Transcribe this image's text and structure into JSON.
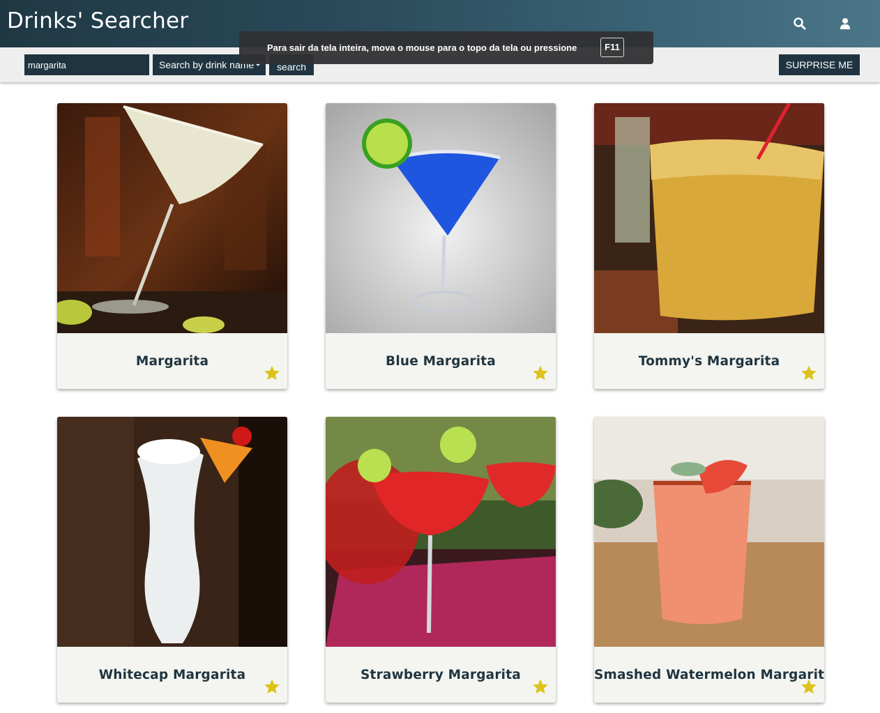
{
  "header": {
    "title": "Drinks' Searcher",
    "icons": [
      "search-icon",
      "user-icon"
    ]
  },
  "search": {
    "query": "margarita",
    "filter_selected": "Search by drink name",
    "search_label": "search",
    "surprise_label": "SURPRISE ME"
  },
  "fullscreen_notice": {
    "message": "Para sair da tela inteira, mova o mouse para o topo da tela ou pressione",
    "key": "F11"
  },
  "drinks": [
    {
      "name": "Margarita",
      "favorite": true
    },
    {
      "name": "Blue Margarita",
      "favorite": true
    },
    {
      "name": "Tommy's Margarita",
      "favorite": true
    },
    {
      "name": "Whitecap Margarita",
      "favorite": true
    },
    {
      "name": "Strawberry Margarita",
      "favorite": true
    },
    {
      "name": "Smashed Watermelon Margarita",
      "favorite": true
    }
  ],
  "colors": {
    "header_dark": "#1f3844",
    "header_light": "#4a7688",
    "control_bg": "#1f3440",
    "card_bg": "#f4f5f0",
    "star": "#dcc31a"
  }
}
